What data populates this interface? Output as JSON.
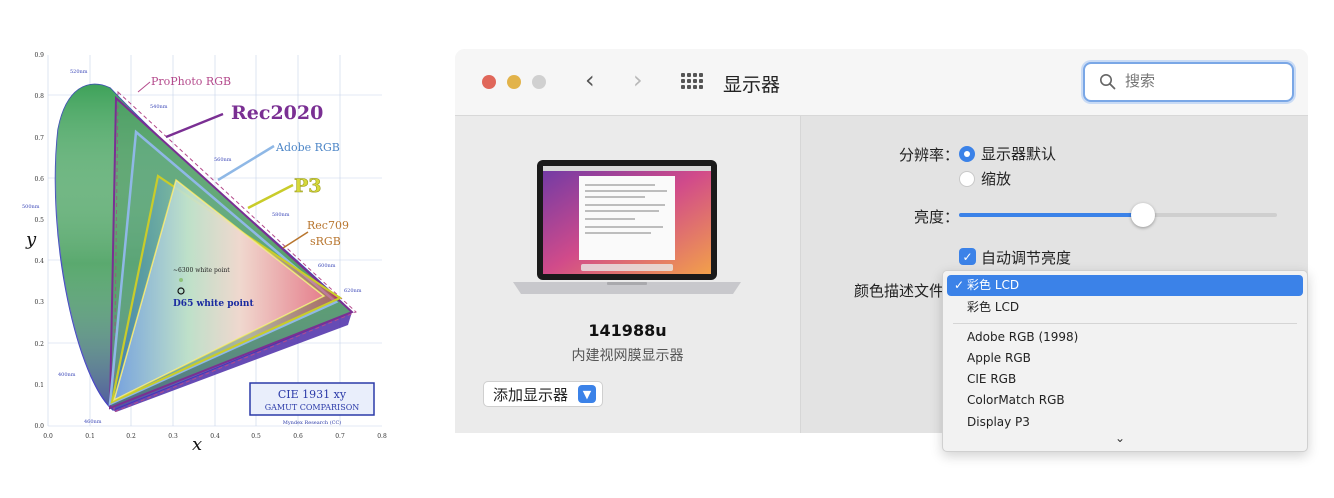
{
  "cie": {
    "y_ticks": [
      "0.9",
      "0.8",
      "0.7",
      "0.6",
      "0.5",
      "0.4",
      "0.3",
      "0.2",
      "0.1",
      "0.0"
    ],
    "x_ticks": [
      "0.0",
      "0.1",
      "0.2",
      "0.3",
      "0.4",
      "0.5",
      "0.6",
      "0.7",
      "0.8"
    ],
    "x_axis": "x",
    "y_axis": "y",
    "wavelengths": [
      "520nm",
      "540nm",
      "560nm",
      "500nm",
      "580nm",
      "600nm",
      "620nm",
      "400nm",
      "460nm"
    ],
    "gamut_labels": {
      "prophoto": "ProPhoto RGB",
      "rec2020": "Rec2020",
      "adobe": "Adobe RGB",
      "p3": "P3",
      "rec709": "Rec709",
      "srgb": "sRGB"
    },
    "white_points": {
      "w6300": "~6300 white point",
      "d65": "D65 white point"
    },
    "box_title": "CIE 1931 xy",
    "box_subtitle": "GAMUT COMPARISON",
    "credit": "Myndex Research (CC)",
    "colors": {
      "rec2020": "#7a2f93",
      "prophoto": "#b44a8c",
      "adobe": "#5a8fd0",
      "p3": "#c9cc2a",
      "rec709": "#b8762f"
    }
  },
  "window": {
    "title": "显示器",
    "search_placeholder": "搜索",
    "icons": {
      "back": "chevron-left-icon",
      "forward": "chevron-right-icon",
      "grid": "grid-icon",
      "search": "search-icon"
    },
    "display": {
      "name": "141988u",
      "description": "内建视网膜显示器"
    },
    "add_display": "添加显示器",
    "resolution": {
      "label": "分辨率：",
      "options": [
        "显示器默认",
        "缩放"
      ],
      "selected": 0
    },
    "brightness": {
      "label": "亮度：",
      "value": 0.58
    },
    "auto_brightness": {
      "label": "自动调节亮度",
      "checked": true
    },
    "color_profile": {
      "label": "颜色描述文件：",
      "selected": "彩色 LCD",
      "items": [
        "彩色 LCD",
        "Adobe RGB (1998)",
        "Apple RGB",
        "CIE RGB",
        "ColorMatch RGB",
        "Display P3"
      ],
      "check": "✓",
      "more": "⌄"
    }
  }
}
